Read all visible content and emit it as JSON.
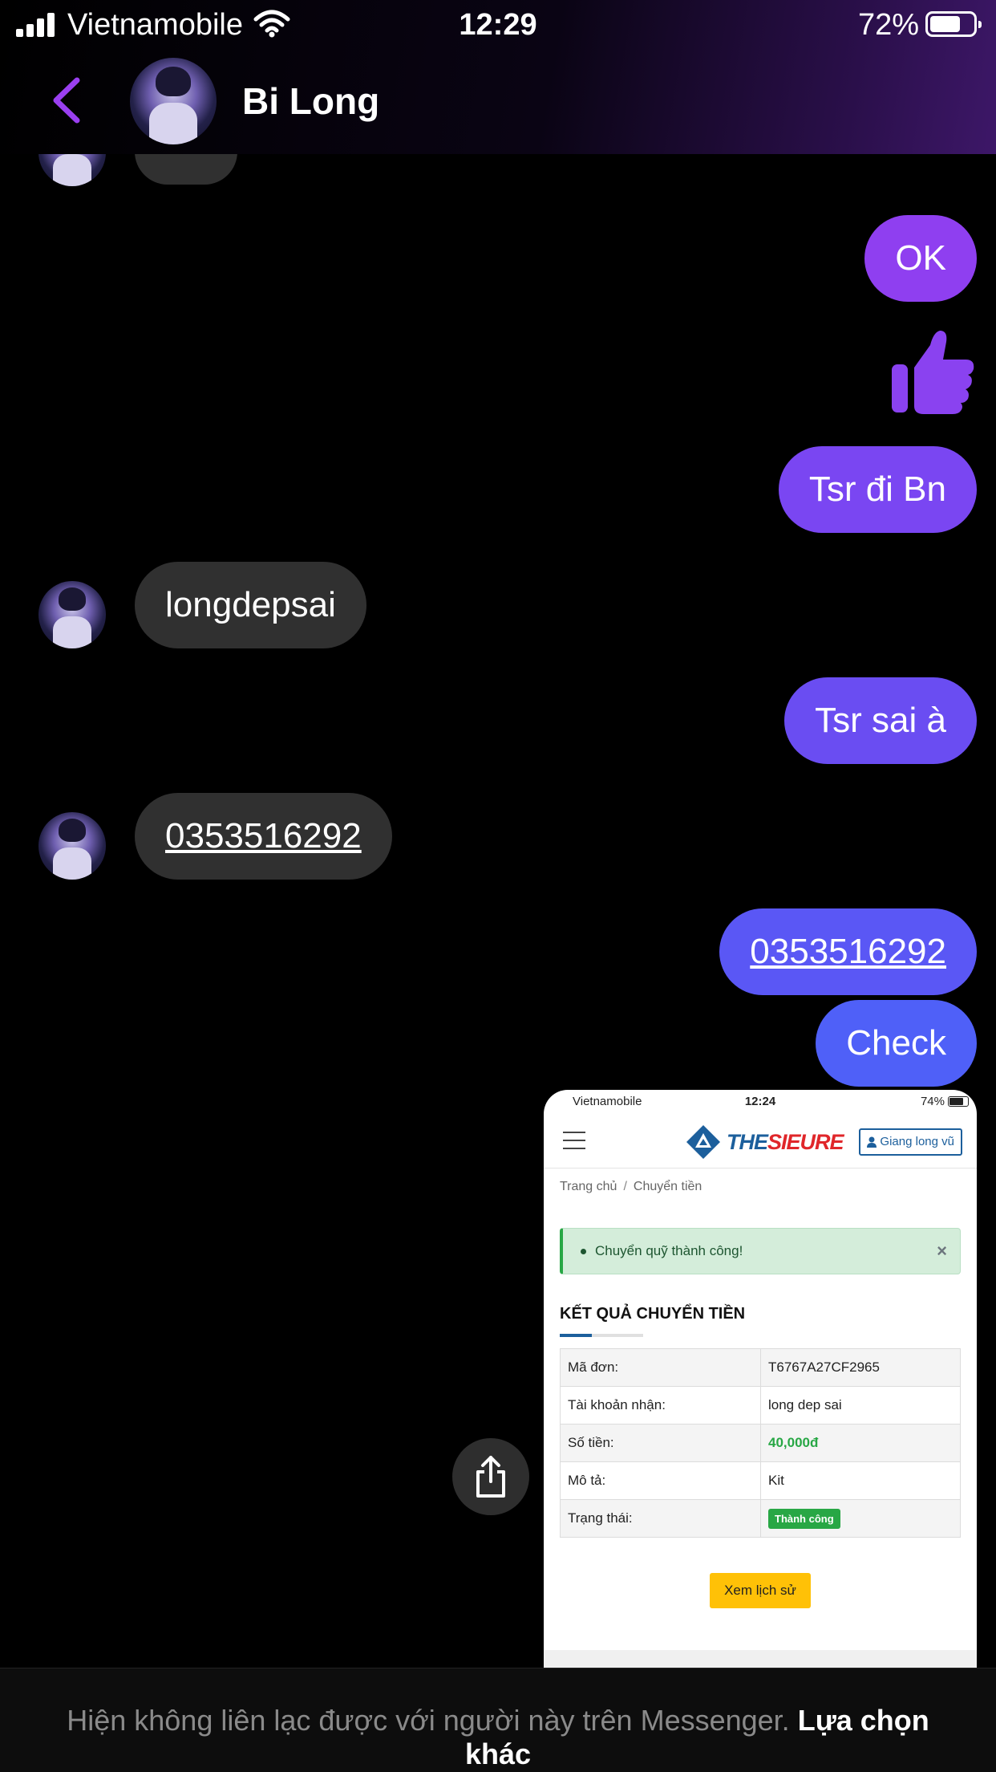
{
  "status_bar": {
    "carrier": "Vietnamobile",
    "time": "12:29",
    "battery": "72%",
    "battery_level": 0.72
  },
  "header": {
    "contact_name": "Bi Long"
  },
  "messages": {
    "ok": "OK",
    "tsr_di_bn": "Tsr đi Bn",
    "longdepsai": "longdepsai",
    "tsr_sai_a": "Tsr sai à",
    "phone_in": "0353516292",
    "phone_out": "0353516292",
    "check": "Check"
  },
  "colors": {
    "purple_top": "#8f3ff0",
    "purple_mid": "#6b4ff0",
    "blue_bottom": "#4f60f8",
    "incoming": "#303030"
  },
  "screenshot": {
    "status": {
      "carrier": "Vietnamobile",
      "time": "12:24",
      "battery": "74%"
    },
    "brand": {
      "the": "THE",
      "rest": "SIEURE"
    },
    "user_button": "Giang long vũ",
    "breadcrumb": {
      "home": "Trang chủ",
      "sep": "/",
      "current": "Chuyển tiền"
    },
    "alert": {
      "text": "Chuyển quỹ thành công!",
      "close": "×"
    },
    "result_title": "KẾT QUẢ CHUYỂN TIỀN",
    "rows": [
      {
        "label": "Mã đơn:",
        "value": "T6767A27CF2965"
      },
      {
        "label": "Tài khoản nhận:",
        "value": "long dep sai"
      },
      {
        "label": "Số tiền:",
        "value": "40,000đ"
      },
      {
        "label": "Mô tả:",
        "value": "Kit"
      },
      {
        "label": "Trạng thái:",
        "value": "Thành công"
      }
    ],
    "history_button": "Xem lịch sử"
  },
  "footer": {
    "text": "Hiện không liên lạc được với người này trên Messenger.",
    "link": "Lựa chọn khác"
  }
}
